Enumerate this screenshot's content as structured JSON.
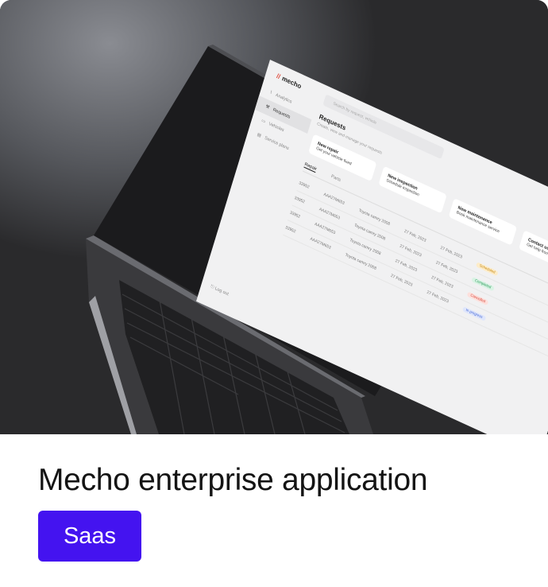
{
  "card": {
    "title": "Mecho enterprise application",
    "tag": "Saas",
    "tag_color": "#4413f0"
  },
  "app": {
    "logo": "mecho",
    "sidebar": [
      "Analytics",
      "Requests",
      "Vehicles",
      "Service plans"
    ],
    "logout": "Log out",
    "search_placeholder": "Search by request, vehicle",
    "page_title": "Requests",
    "page_subtitle": "Create, view and manage your requests",
    "quick_actions": [
      {
        "title": "New repair",
        "sub": "Get your vehicle fixed"
      },
      {
        "title": "New inspection",
        "sub": "Schedule inspection"
      },
      {
        "title": "New maintenance",
        "sub": "Book maintenance service"
      },
      {
        "title": "Contact us",
        "sub": "Get help from our team"
      }
    ],
    "tabs": [
      "Repair",
      "Parts"
    ],
    "rows": [
      {
        "id": "33952",
        "ref": "AAA27M653",
        "vehicle": "Toyota camry 2008",
        "date1": "27 Feb, 2023",
        "date2": "27 Feb, 2023",
        "status": "Scheduled"
      },
      {
        "id": "33952",
        "ref": "AAA27M653",
        "vehicle": "Toyota camry 2008",
        "date1": "27 Feb, 2023",
        "date2": "27 Feb, 2023",
        "status": "Completed"
      },
      {
        "id": "33952",
        "ref": "AAA27M653",
        "vehicle": "Toyota camry 2008",
        "date1": "27 Feb, 2023",
        "date2": "27 Feb, 2023",
        "status": "Cancelled"
      },
      {
        "id": "33952",
        "ref": "AAA27M653",
        "vehicle": "Toyota camry 2008",
        "date1": "27 Feb, 2023",
        "date2": "27 Feb, 2023",
        "status": "In progress"
      }
    ]
  }
}
